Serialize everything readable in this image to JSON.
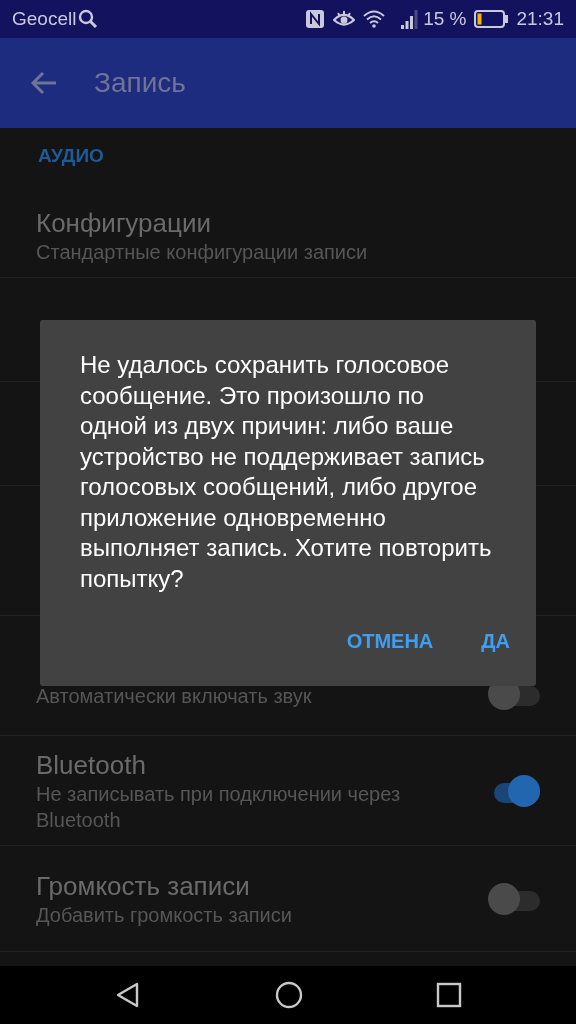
{
  "status_bar": {
    "carrier": "Geocell",
    "battery_percent": "15 %",
    "time": "21:31"
  },
  "app_bar": {
    "title": "Запись"
  },
  "section": {
    "header": "АУДИО"
  },
  "settings": [
    {
      "kind": "text",
      "title": "Конфигурации",
      "subtitle": "Стандартные конфигурации записи"
    },
    {
      "kind": "hidden"
    },
    {
      "kind": "hidden"
    },
    {
      "kind": "hidden"
    },
    {
      "kind": "switch",
      "subtitle": "Автоматически включать звук",
      "on": false
    },
    {
      "kind": "switch",
      "title": "Bluetooth",
      "subtitle": "Не записывать при подключении через Bluetooth",
      "on": true
    },
    {
      "kind": "switch",
      "title": "Громкость записи",
      "subtitle": "Добавить громкость записи",
      "on": false
    }
  ],
  "dialog": {
    "message": "Не удалось сохранить голосовое сообщение. Это произошло по одной из двух причин: либо ваше устройство не поддерживает запись голосовых сообщений, либо другое приложение одновременно выполняет запись. Хотите повторить попытку?",
    "buttons": [
      "ОТМЕНА",
      "ДА"
    ]
  }
}
